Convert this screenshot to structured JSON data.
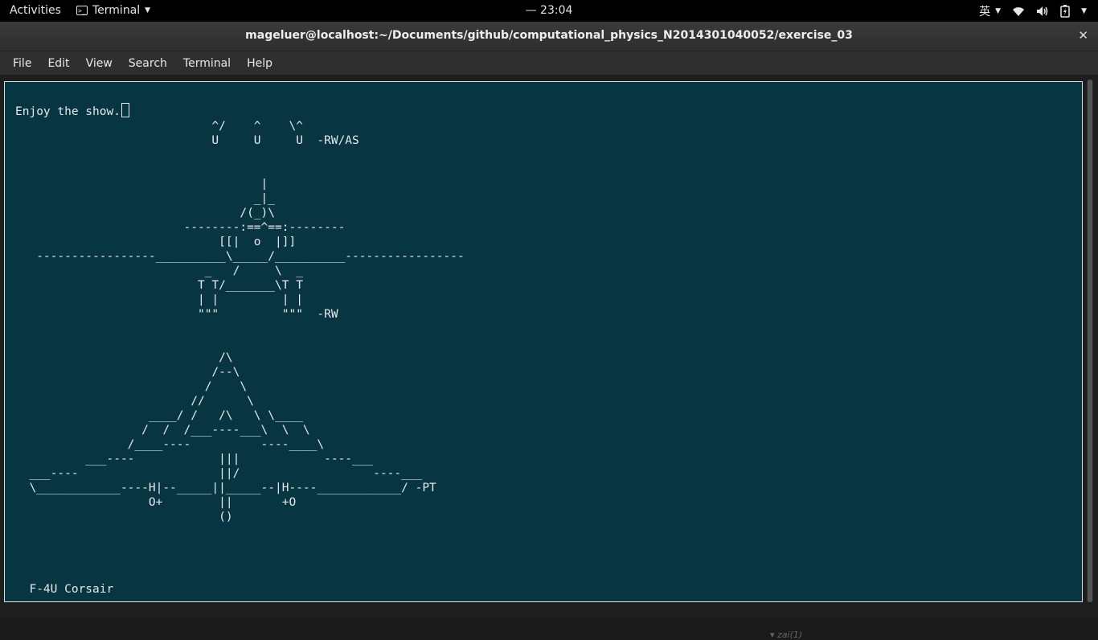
{
  "topbar": {
    "activities": "Activities",
    "app_name": "Terminal",
    "clock": "— 23:04",
    "input_method": "英"
  },
  "window": {
    "title": "mageluer@localhost:~/Documents/github/computational_physics_N2014301040052/exercise_03",
    "close": "✕"
  },
  "menu": {
    "items": [
      "File",
      "Edit",
      "View",
      "Search",
      "Terminal",
      "Help"
    ]
  },
  "terminal": {
    "prompt_line": "Enjoy the show.",
    "art": "                            ^/    ^    \\^\n                            U     U     U  -RW/AS\n\n\n                                   |\n                                  _|_\n                                /(_)\\\n                        --------:==^==:--------\n                             [[|  o  |]]\n   -----------------__________\\_____/__________-----------------\n                           _   /     \\  _\n                          T T/_______\\T T\n                          | |         | |\n                          \"\"\"         \"\"\"  -RW\n\n\n                             /\\\n                            /--\\\n                           /    \\\n                         //      \\\n                   ____/ /   /\\   \\ \\____\n                  /  /  /___----___\\  \\  \\\n                /____----          ----____\\\n          ___----            |||            ----___\n  ___----                    ||/                   ----___\n  \\____________----H|--_____||_____--|H----____________/ -PT\n                   O+        ||       +O\n                             ()\n\n\n\n\n  F-4U Corsair",
    "ghost_text": "▾ zai(1)"
  }
}
